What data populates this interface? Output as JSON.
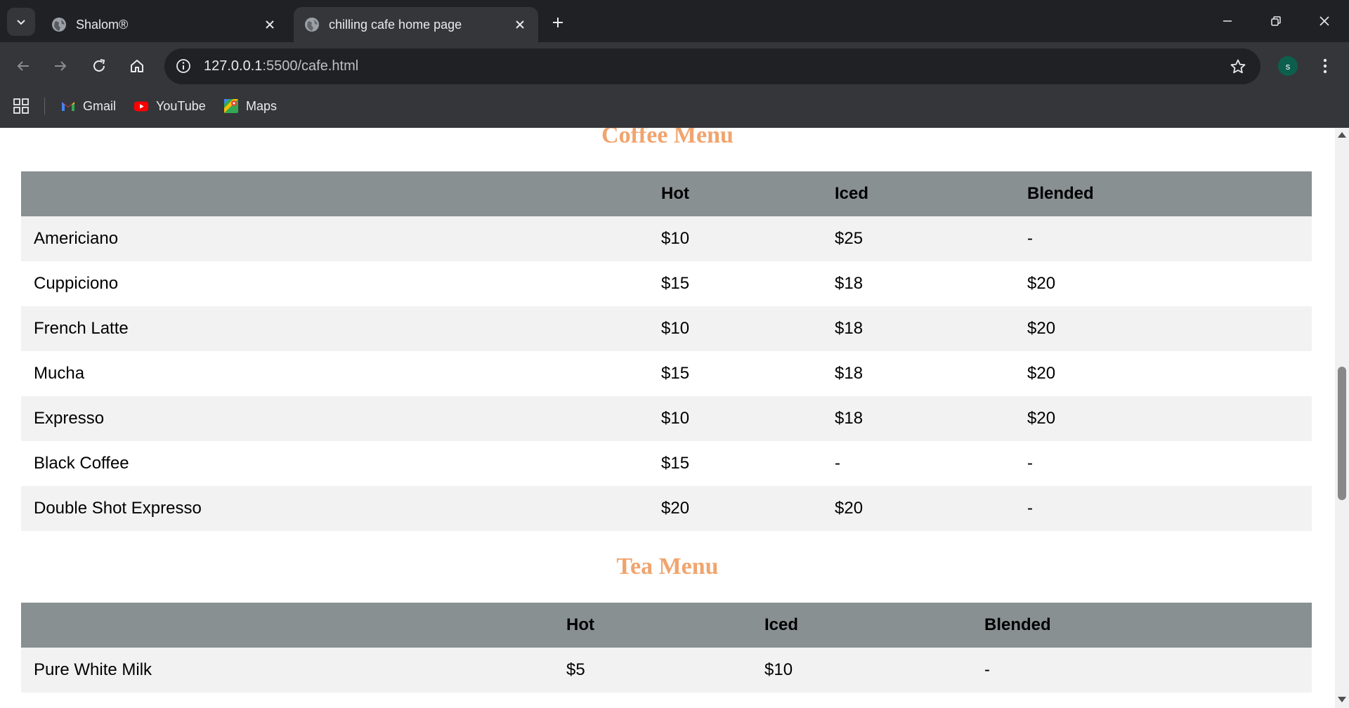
{
  "browser": {
    "tabs": [
      {
        "title": "Shalom®",
        "active": false
      },
      {
        "title": "chilling cafe home page",
        "active": true
      }
    ],
    "url_host": "127.0.0.1",
    "url_path": ":5500/cafe.html",
    "profile_initial": "s",
    "bookmarks": [
      {
        "label": "Gmail",
        "icon": "gmail-icon"
      },
      {
        "label": "YouTube",
        "icon": "youtube-icon"
      },
      {
        "label": "Maps",
        "icon": "maps-icon"
      }
    ]
  },
  "coffee_menu": {
    "title": "Coffee Menu",
    "headers": [
      "",
      "Hot",
      "Iced",
      "Blended"
    ],
    "rows": [
      [
        "Americiano",
        "$10",
        "$25",
        "-"
      ],
      [
        "Cuppiciono",
        "$15",
        "$18",
        "$20"
      ],
      [
        "French Latte",
        "$10",
        "$18",
        "$20"
      ],
      [
        "Mucha",
        "$15",
        "$18",
        "$20"
      ],
      [
        "Expresso",
        "$10",
        "$18",
        "$20"
      ],
      [
        "Black Coffee",
        "$15",
        "-",
        "-"
      ],
      [
        "Double Shot Expresso",
        "$20",
        "$20",
        "-"
      ]
    ]
  },
  "tea_menu": {
    "title": "Tea Menu",
    "headers": [
      "",
      "Hot",
      "Iced",
      "Blended"
    ],
    "rows": [
      [
        "Pure White Milk",
        "$5",
        "$10",
        "-"
      ]
    ]
  },
  "colors": {
    "menu_title": "#f0a46e",
    "table_header": "#899092",
    "row_stripe": "#f2f2f2"
  }
}
